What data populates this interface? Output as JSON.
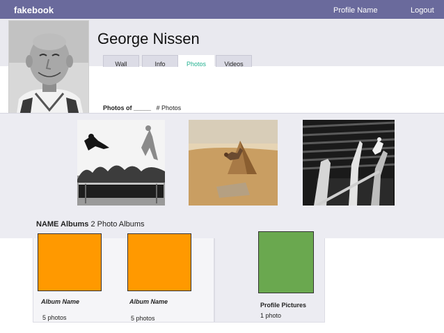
{
  "topbar": {
    "brand": "fakebook",
    "profile_link": "Profile Name",
    "logout_link": "Logout"
  },
  "profile": {
    "name": "George Nissen"
  },
  "tabs": [
    {
      "label": "Wall",
      "active": false
    },
    {
      "label": "Info",
      "active": false
    },
    {
      "label": "Photos",
      "active": true
    },
    {
      "label": "Videos",
      "active": false
    }
  ],
  "photos_section": {
    "heading_bold": "Photos of _____",
    "heading_count": "# Photos",
    "photos": [
      {
        "alt": "trampoline-jump-photo"
      },
      {
        "alt": "pyramid-jump-photo"
      },
      {
        "alt": "stadium-stunt-photo"
      }
    ]
  },
  "albums_section": {
    "heading_bold": "NAME Albums",
    "heading_count": "2 Photo Albums",
    "albums": [
      {
        "name": "Album Name",
        "count": "5 photos",
        "color": "#ff9900"
      },
      {
        "name": "Album Name",
        "count": "5 photos",
        "color": "#ff9900"
      }
    ],
    "profile_album": {
      "name": "Profile Pictures",
      "count": "1 photo",
      "color": "#6aa84f"
    }
  },
  "colors": {
    "topbar": "#6a6a9c",
    "active_tab_text": "#22b090"
  }
}
